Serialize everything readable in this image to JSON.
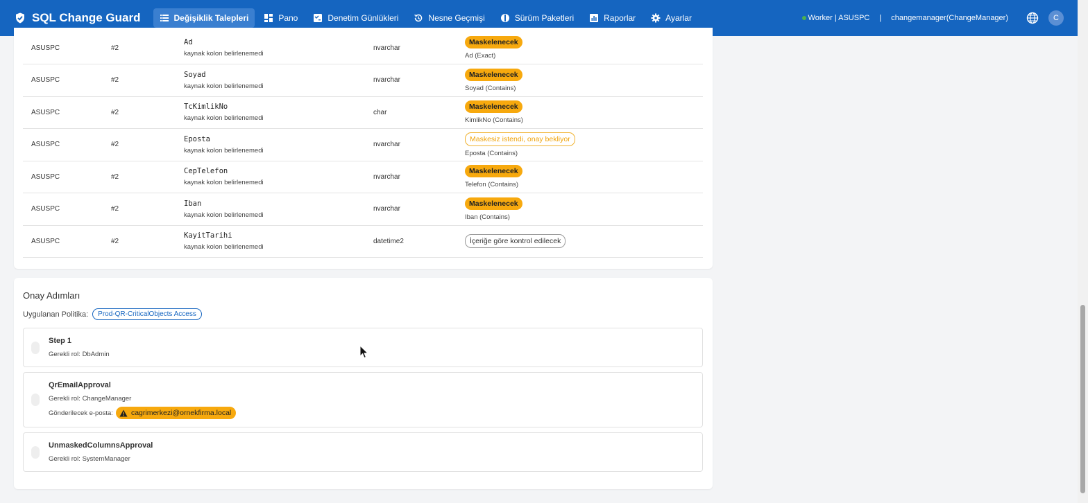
{
  "app": {
    "title": "SQL Change Guard"
  },
  "nav": [
    {
      "label": "Değişiklik Talepleri",
      "icon": "list-icon",
      "active": true
    },
    {
      "label": "Pano",
      "icon": "dashboard-icon",
      "active": false
    },
    {
      "label": "Denetim Günlükleri",
      "icon": "audit-log-icon",
      "active": false
    },
    {
      "label": "Nesne Geçmişi",
      "icon": "history-icon",
      "active": false
    },
    {
      "label": "Sürüm Paketleri",
      "icon": "package-icon",
      "active": false
    },
    {
      "label": "Raporlar",
      "icon": "chart-icon",
      "active": false
    },
    {
      "label": "Ayarlar",
      "icon": "gear-icon",
      "active": false
    }
  ],
  "header_right": {
    "worker": "Worker | ASUSPC",
    "separator": "|",
    "user": "changemanager(ChangeManager)",
    "avatar_initial": "C"
  },
  "columns_table": {
    "rows": [
      {
        "server": "ASUSPC",
        "req": "#2",
        "column": "Ad",
        "source": "kaynak kolon belirlenemedi",
        "type": "nvarchar",
        "status": "Maskelenecek",
        "status_kind": "mask",
        "rule": "Ad (Exact)"
      },
      {
        "server": "ASUSPC",
        "req": "#2",
        "column": "Soyad",
        "source": "kaynak kolon belirlenemedi",
        "type": "nvarchar",
        "status": "Maskelenecek",
        "status_kind": "mask",
        "rule": "Soyad (Contains)"
      },
      {
        "server": "ASUSPC",
        "req": "#2",
        "column": "TcKimlikNo",
        "source": "kaynak kolon belirlenemedi",
        "type": "char",
        "status": "Maskelenecek",
        "status_kind": "mask",
        "rule": "KimlikNo (Contains)"
      },
      {
        "server": "ASUSPC",
        "req": "#2",
        "column": "Eposta",
        "source": "kaynak kolon belirlenemedi",
        "type": "nvarchar",
        "status": "Maskesiz istendi, onay bekliyor",
        "status_kind": "pending",
        "rule": "Eposta (Contains)"
      },
      {
        "server": "ASUSPC",
        "req": "#2",
        "column": "CepTelefon",
        "source": "kaynak kolon belirlenemedi",
        "type": "nvarchar",
        "status": "Maskelenecek",
        "status_kind": "mask",
        "rule": "Telefon (Contains)"
      },
      {
        "server": "ASUSPC",
        "req": "#2",
        "column": "Iban",
        "source": "kaynak kolon belirlenemedi",
        "type": "nvarchar",
        "status": "Maskelenecek",
        "status_kind": "mask",
        "rule": "Iban (Contains)"
      },
      {
        "server": "ASUSPC",
        "req": "#2",
        "column": "KayitTarihi",
        "source": "kaynak kolon belirlenemedi",
        "type": "datetime2",
        "status": "İçeriğe göre kontrol edilecek",
        "status_kind": "check",
        "rule": ""
      }
    ]
  },
  "approval": {
    "title": "Onay Adımları",
    "policy_label": "Uygulanan Politika:",
    "policy_name": "Prod-QR-CriticalObjects Access",
    "steps": [
      {
        "name": "Step 1",
        "role": "Gerekli rol: DbAdmin"
      },
      {
        "name": "QrEmailApproval",
        "role": "Gerekli rol: ChangeManager",
        "email_label": "Gönderilecek e-posta:",
        "email": "cagrimerkezi@ornekfirma.local"
      },
      {
        "name": "UnmaskedColumnsApproval",
        "role": "Gerekli rol: SystemManager"
      }
    ]
  },
  "colors": {
    "primary": "#1565c0",
    "mask_badge": "#f7a90e",
    "pending_badge": "#f0a30a"
  }
}
